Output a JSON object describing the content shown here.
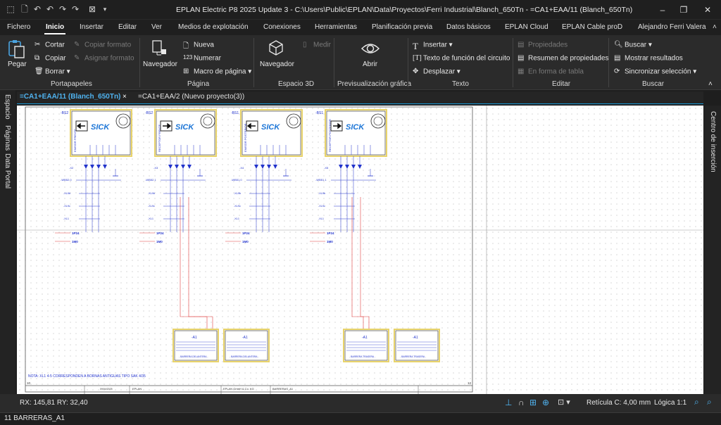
{
  "window": {
    "title": "EPLAN Electric P8 2025 Update 3 - C:\\Users\\Public\\EPLAN\\Data\\Proyectos\\Ferri Industrial\\Blanch_650Tn - =CA1+EAA/11 (Blanch_650Tn)",
    "user": "Alejandro Ferri Valera"
  },
  "menu": [
    "Fichero",
    "Inicio",
    "Insertar",
    "Editar",
    "Ver",
    "Medios de explotación",
    "Conexiones",
    "Herramientas",
    "Planificación previa",
    "Datos básicos",
    "EPLAN Cloud",
    "EPLAN Cable proD"
  ],
  "ribbon": {
    "paste": "Pegar",
    "cut": "Cortar",
    "copy": "Copiar",
    "delete": "Borrar",
    "copy_format": "Copiar formato",
    "assign_format": "Asignar formato",
    "group_clipboard": "Portapapeles",
    "navigator_page": "Navegador",
    "new": "Nueva",
    "number": "Numerar",
    "page_macro": "Macro de página",
    "group_page": "Página",
    "navigator_3d": "Navegador",
    "measure": "Medir",
    "group_3d": "Espacio 3D",
    "open": "Abrir",
    "group_preview": "Previsualización gráfica",
    "insert": "Insertar",
    "function_text": "Texto de función del circuito",
    "move": "Desplazar",
    "group_text": "Texto",
    "properties": "Propiedades",
    "properties_summary": "Resumen de propiedades",
    "table_form": "En forma de tabla",
    "group_edit": "Editar",
    "search": "Buscar",
    "show_results": "Mostrar resultados",
    "sync_selection": "Sincronizar selección",
    "group_search": "Buscar"
  },
  "tabs": [
    "=CA1+EAA/11 (Blanch_650Tn)",
    "=CA1+EAA/2 (Nuevo proyecto(3))"
  ],
  "left_panels": [
    "Espacio",
    "Páginas",
    "Data Portal"
  ],
  "right_panel": "Centro de inserción",
  "drawing": {
    "sensors": [
      {
        "tag": "-BS2",
        "name": "EMISOR FRENTE",
        "brand": "SICK",
        "conn": "-X2",
        "plc": "-WB52.0",
        "arrow": "left"
      },
      {
        "tag": "-BS2",
        "name": "RECEPTOR FRENTE",
        "brand": "SICK",
        "conn": "-X3",
        "plc": "-WB52.1",
        "arrow": "right"
      },
      {
        "tag": "-BS1",
        "name": "EMISOR POSTERIOR",
        "brand": "SICK",
        "conn": "-X4",
        "plc": "-WB51.0",
        "arrow": "left"
      },
      {
        "tag": "-BS1",
        "name": "RECEPTOR POSTERIOR",
        "brand": "SICK",
        "conn": "-X5",
        "plc": "-WB51.1",
        "arrow": "right"
      }
    ],
    "terminals": [
      "-XL9b",
      "-XL9c",
      "-XL1"
    ],
    "supply_labels": [
      "1P24",
      "1M0"
    ],
    "modules": [
      {
        "tag": "-A1",
        "caption": "- BARRERA DELANTERA -"
      },
      {
        "tag": "-A1",
        "caption": "- BARRERA DELANTERA -"
      },
      {
        "tag": "-A1",
        "caption": "- BARRERA TRASERA -"
      },
      {
        "tag": "-A1",
        "caption": "- BARRERA TRASERA -"
      }
    ],
    "note": "NOTA: XL1 4-5 CORRESPONDEN A BORNAS ANTIGUAS TIPO SAK 4/35",
    "titleblock": {
      "company": "EPLAN",
      "company2": "EPLAN GmbH & Co. KG",
      "page_title": "BARRERAS_A1",
      "date": "09/04/2025",
      "col_left": "10",
      "col_right": "12"
    }
  },
  "status": {
    "coords": "RX: 145,81 RY: 32,40",
    "grid": "Retícula C: 4,00 mm",
    "logic": "Lógica 1:1"
  },
  "bottom": {
    "page": "11 BARRERAS_A1"
  }
}
